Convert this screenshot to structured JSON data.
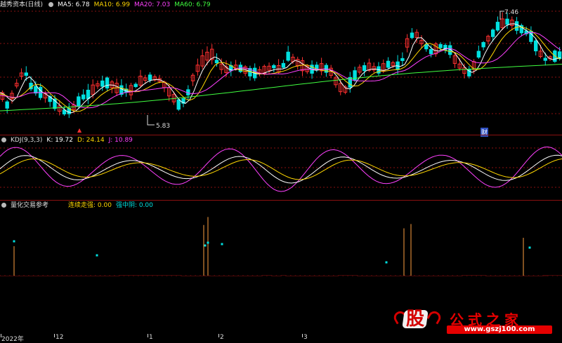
{
  "main": {
    "title": "越秀资本(日线)",
    "ma": [
      {
        "label": "MA5: 6.78",
        "color": "#ffffff"
      },
      {
        "label": "MA10: 6.99",
        "color": "#ffd700"
      },
      {
        "label": "MA20: 7.03",
        "color": "#ff40ff"
      },
      {
        "label": "MA60: 6.79",
        "color": "#40ff40"
      }
    ],
    "high_label": "7.46",
    "low_label": "5.83",
    "marker_fin": "财"
  },
  "kdj": {
    "title": "KDJ(9,3,3)",
    "k": "K: 19.72",
    "d": "D: 24.14",
    "j": "J: 10.89"
  },
  "quant": {
    "title": "量化交易参考",
    "strong": "连续走强: 0.00",
    "weak": "强中阴: 0.00"
  },
  "xaxis": [
    "2022年",
    "12",
    "1",
    "2",
    "3"
  ],
  "brand": {
    "char": "股",
    "name": "公式之家",
    "url": "www.gszj100.com"
  },
  "colors": {
    "up": "#ff3030",
    "down": "#00e0e0",
    "bar_up": "#e02000",
    "bar_down": "#00e000",
    "grid": "#8a1010"
  }
}
